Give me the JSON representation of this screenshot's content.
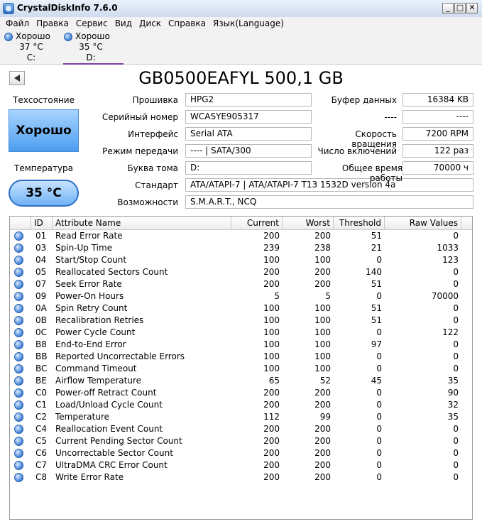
{
  "window": {
    "title": "CrystalDiskInfo 7.6.0",
    "min": "_",
    "max": "□",
    "close": "✕"
  },
  "menu": [
    "Файл",
    "Правка",
    "Сервис",
    "Вид",
    "Диск",
    "Справка",
    "Язык(Language)"
  ],
  "disks": [
    {
      "status": "Хорошо",
      "temp": "37 °C",
      "letter": "C:"
    },
    {
      "status": "Хорошо",
      "temp": "35 °C",
      "letter": "D:"
    }
  ],
  "disk_title": "GB0500EAFYL 500,1 GB",
  "health": {
    "label": "Техсостояние",
    "value": "Хорошо",
    "color": "#4c9df0"
  },
  "temperature": {
    "label": "Температура",
    "value": "35 °C"
  },
  "fields": {
    "firmware": {
      "label": "Прошивка",
      "value": "HPG2"
    },
    "serial": {
      "label": "Серийный номер",
      "value": "WCASYE905317"
    },
    "interface": {
      "label": "Интерфейс",
      "value": "Serial ATA"
    },
    "transfer": {
      "label": "Режим передачи",
      "value": "---- | SATA/300"
    },
    "drive_letter": {
      "label": "Буква тома",
      "value": "D:"
    },
    "standard": {
      "label": "Стандарт",
      "value": "ATA/ATAPI-7 | ATA/ATAPI-7 T13 1532D version 4a"
    },
    "features": {
      "label": "Возможности",
      "value": "S.M.A.R.T., NCQ"
    },
    "buffer": {
      "label": "Буфер данных",
      "value": "16384 KB"
    },
    "unk_label": "----",
    "unk_value": "----",
    "rotation": {
      "label": "Скорость вращения",
      "value": "7200 RPM"
    },
    "power_count": {
      "label": "Число включений",
      "value": "122 раз"
    },
    "power_hours": {
      "label": "Общее время работы",
      "value": "70000 ч"
    }
  },
  "table": {
    "headers": [
      "ID",
      "Attribute Name",
      "Current",
      "Worst",
      "Threshold",
      "Raw Values"
    ],
    "rows": [
      [
        "01",
        "Read Error Rate",
        "200",
        "200",
        "51",
        "0"
      ],
      [
        "03",
        "Spin-Up Time",
        "239",
        "238",
        "21",
        "1033"
      ],
      [
        "04",
        "Start/Stop Count",
        "100",
        "100",
        "0",
        "123"
      ],
      [
        "05",
        "Reallocated Sectors Count",
        "200",
        "200",
        "140",
        "0"
      ],
      [
        "07",
        "Seek Error Rate",
        "200",
        "200",
        "51",
        "0"
      ],
      [
        "09",
        "Power-On Hours",
        "5",
        "5",
        "0",
        "70000"
      ],
      [
        "0A",
        "Spin Retry Count",
        "100",
        "100",
        "51",
        "0"
      ],
      [
        "0B",
        "Recalibration Retries",
        "100",
        "100",
        "51",
        "0"
      ],
      [
        "0C",
        "Power Cycle Count",
        "100",
        "100",
        "0",
        "122"
      ],
      [
        "B8",
        "End-to-End Error",
        "100",
        "100",
        "97",
        "0"
      ],
      [
        "BB",
        "Reported Uncorrectable Errors",
        "100",
        "100",
        "0",
        "0"
      ],
      [
        "BC",
        "Command Timeout",
        "100",
        "100",
        "0",
        "0"
      ],
      [
        "BE",
        "Airflow Temperature",
        "65",
        "52",
        "45",
        "35"
      ],
      [
        "C0",
        "Power-off Retract Count",
        "200",
        "200",
        "0",
        "90"
      ],
      [
        "C1",
        "Load/Unload Cycle Count",
        "200",
        "200",
        "0",
        "32"
      ],
      [
        "C2",
        "Temperature",
        "112",
        "99",
        "0",
        "35"
      ],
      [
        "C4",
        "Reallocation Event Count",
        "200",
        "200",
        "0",
        "0"
      ],
      [
        "C5",
        "Current Pending Sector Count",
        "200",
        "200",
        "0",
        "0"
      ],
      [
        "C6",
        "Uncorrectable Sector Count",
        "200",
        "200",
        "0",
        "0"
      ],
      [
        "C7",
        "UltraDMA CRC Error Count",
        "200",
        "200",
        "0",
        "0"
      ],
      [
        "C8",
        "Write Error Rate",
        "200",
        "200",
        "0",
        "0"
      ]
    ]
  }
}
